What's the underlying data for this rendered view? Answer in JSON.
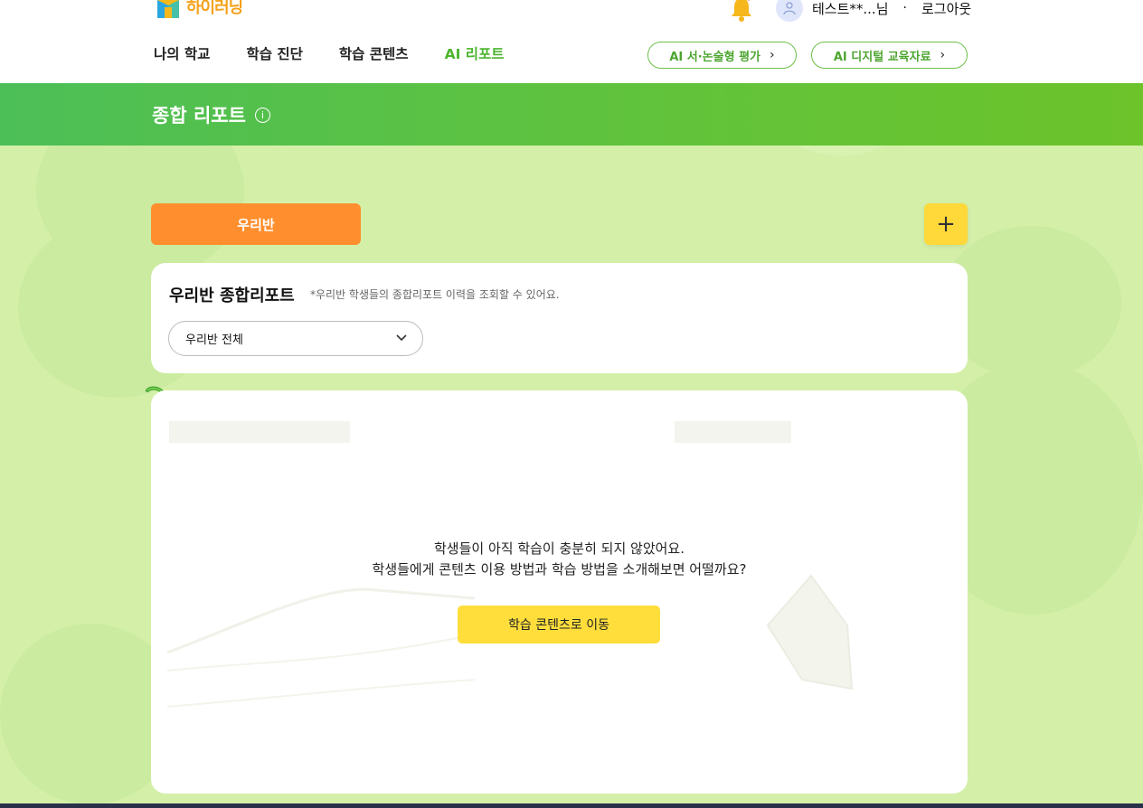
{
  "brand": {
    "logo_text": "하이러닝",
    "accent": "#4cb52f"
  },
  "user": {
    "name": "테스트**...님",
    "separator": "·",
    "logout": "로그아웃"
  },
  "nav": {
    "items": [
      {
        "label": "나의 학교",
        "active": false
      },
      {
        "label": "학습 진단",
        "active": false
      },
      {
        "label": "학습 콘텐츠",
        "active": false
      },
      {
        "label": "AI 리포트",
        "active": true
      }
    ],
    "pill_buttons": [
      {
        "label": "AI 서·논술형 평가"
      },
      {
        "label": "AI 디지털 교육자료"
      }
    ]
  },
  "banner": {
    "title": "종합 리포트",
    "info_icon": "info-icon"
  },
  "class_tabs": [
    {
      "label": "우리반"
    }
  ],
  "add_button": {
    "icon": "plus-icon",
    "symbol": "+"
  },
  "report": {
    "title": "우리반 종합리포트",
    "description": "*우리반 학생들의 종합리포트 이력을 조회할 수 있어요.",
    "select": {
      "value": "우리반 전체"
    }
  },
  "empty_state": {
    "line1": "학생들이 아직 학습이 충분히 되지 않았어요.",
    "line2": "학생들에게 콘텐츠 이용 방법과 학습 방법을 소개해보면 어떨까요?",
    "cta": "학습 콘텐츠로 이동"
  }
}
